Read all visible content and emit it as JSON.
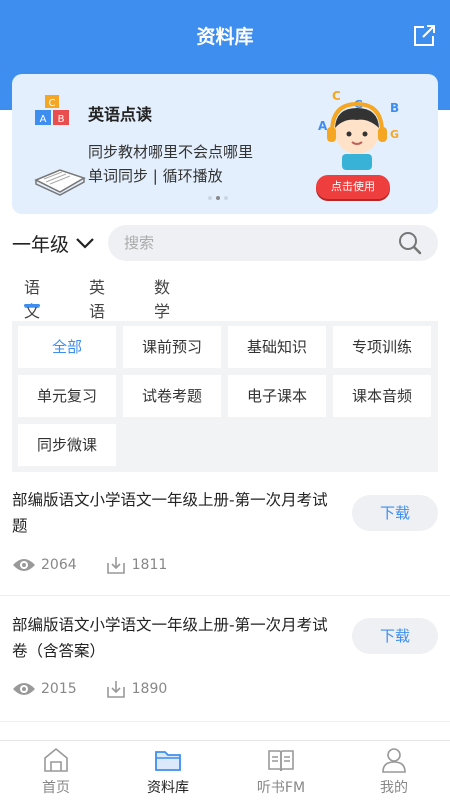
{
  "header": {
    "title": "资料库",
    "share_icon": "share-icon"
  },
  "banner": {
    "title": "英语点读",
    "line1": "同步教材哪里不会点哪里",
    "line2": "单词同步 | 循环播放",
    "cta": "点击使用",
    "letters": [
      "C",
      "G",
      "B",
      "A",
      "G"
    ]
  },
  "filter": {
    "grade": "一年级",
    "search_placeholder": "搜索"
  },
  "subject_tabs": [
    {
      "label": "语文",
      "active": true
    },
    {
      "label": "英语",
      "active": false
    },
    {
      "label": "数学",
      "active": false
    }
  ],
  "categories": [
    "全部",
    "课前预习",
    "基础知识",
    "专项训练",
    "单元复习",
    "试卷考题",
    "电子课本",
    "课本音频",
    "同步微课"
  ],
  "items": [
    {
      "title": "部编版语文小学语文一年级上册-第一次月考试题",
      "views": "2064",
      "downloads": "1811",
      "button": "下载"
    },
    {
      "title": "部编版语文小学语文一年级上册-第一次月考试卷（含答案）",
      "views": "2015",
      "downloads": "1890",
      "button": "下载"
    }
  ],
  "tabbar": [
    {
      "label": "首页",
      "icon": "home-icon",
      "active": false
    },
    {
      "label": "资料库",
      "icon": "folder-icon",
      "active": true
    },
    {
      "label": "听书FM",
      "icon": "book-icon",
      "active": false
    },
    {
      "label": "我的",
      "icon": "user-icon",
      "active": false
    }
  ],
  "colors": {
    "primary": "#3e8ef0",
    "banner_bg": "#e3effd",
    "cta": "#ee3e3e"
  }
}
